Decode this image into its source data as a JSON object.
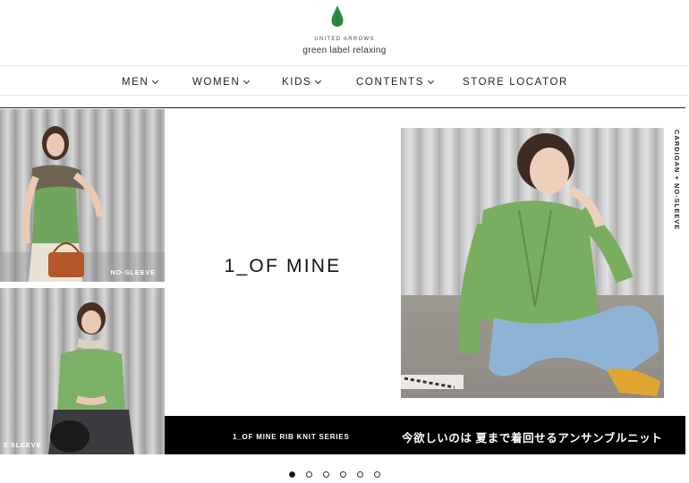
{
  "header": {
    "logo_icon": "leaf-drop-icon",
    "logo_sub": "UNITED ARROWS",
    "logo_main": "green label relaxing"
  },
  "nav": {
    "men": "MEN",
    "women": "WOMEN",
    "kids": "KIDS",
    "contents": "CONTENTS",
    "store_locator": "STORE LOCATOR"
  },
  "hero": {
    "title": "1_OF MINE",
    "photo_left_top_label": "NO-SLEEVE",
    "photo_left_bottom_label": "5 SLEEVE",
    "vertical_label": "CARDIGAN + NO-SLEEVE",
    "bar_left": "1_OF MINE RIB KNIT SERIES",
    "bar_right": "今欲しいのは 夏まで着回せるアンサンブルニット"
  },
  "carousel": {
    "slide_count": 6,
    "active_index": 0
  },
  "colors": {
    "accent_green": "#2e8b3e",
    "knit_green": "#7fb26a",
    "bar_black": "#000000"
  }
}
